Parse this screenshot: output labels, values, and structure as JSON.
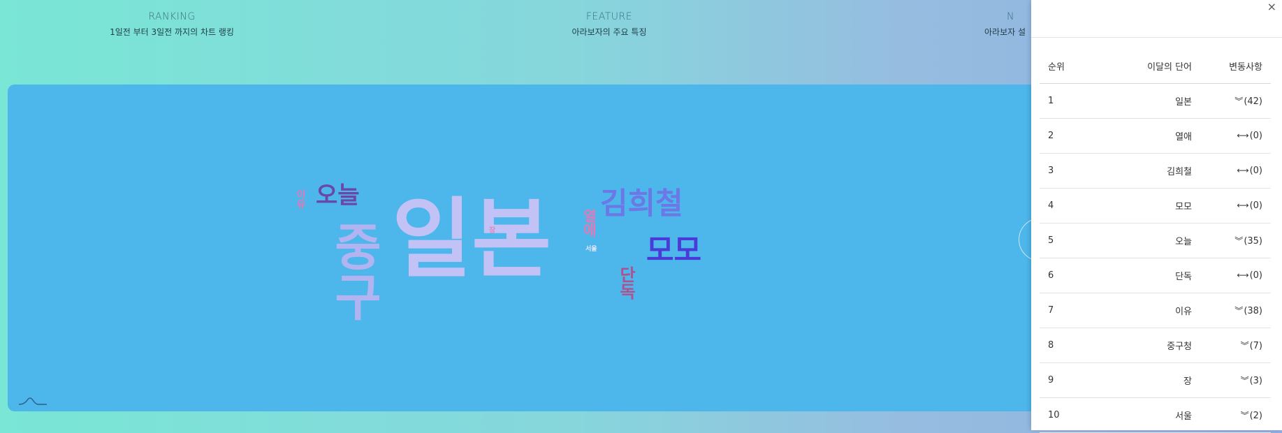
{
  "nav": [
    {
      "title": "RANKING",
      "subtitle": "1일전 부터 3일전 까지의 차트 랭킹"
    },
    {
      "title": "FEATURE",
      "subtitle": "아라보자의 주요 특징"
    },
    {
      "title": "N",
      "subtitle": "아라보자 설"
    }
  ],
  "cloud": {
    "words": [
      "일본",
      "중구",
      "김희철",
      "모모",
      "오늘",
      "열애",
      "단독",
      "이유",
      "서울",
      "장"
    ],
    "colors": {
      "panel": "#4db6ea",
      "lavender": "#c2c2f6",
      "purple": "#6a48a8",
      "indigo": "#4a3ad8",
      "violet": "#6b78e6",
      "pink": "#e07ab8",
      "magenta": "#b0508e"
    }
  },
  "drawer": {
    "close_label": "×",
    "headers": {
      "rank": "순위",
      "word": "이달의 단어",
      "change": "변동사항"
    },
    "rows": [
      {
        "rank": "1",
        "word": "일본",
        "icon": "double-chevron-down-icon",
        "glyph": "︾",
        "change": "(42)"
      },
      {
        "rank": "2",
        "word": "열애",
        "icon": "left-right-arrow-icon",
        "glyph": "⟷",
        "change": "(0)"
      },
      {
        "rank": "3",
        "word": "김희철",
        "icon": "left-right-arrow-icon",
        "glyph": "⟷",
        "change": "(0)"
      },
      {
        "rank": "4",
        "word": "모모",
        "icon": "left-right-arrow-icon",
        "glyph": "⟷",
        "change": "(0)"
      },
      {
        "rank": "5",
        "word": "오늘",
        "icon": "double-chevron-down-icon",
        "glyph": "︾",
        "change": "(35)"
      },
      {
        "rank": "6",
        "word": "단독",
        "icon": "left-right-arrow-icon",
        "glyph": "⟷",
        "change": "(0)"
      },
      {
        "rank": "7",
        "word": "이유",
        "icon": "double-chevron-down-icon",
        "glyph": "︾",
        "change": "(38)"
      },
      {
        "rank": "8",
        "word": "중구청",
        "icon": "double-chevron-down-icon",
        "glyph": "︾",
        "change": "(7)"
      },
      {
        "rank": "9",
        "word": "장",
        "icon": "double-chevron-down-icon",
        "glyph": "︾",
        "change": "(3)"
      },
      {
        "rank": "10",
        "word": "서울",
        "icon": "double-chevron-down-icon",
        "glyph": "︾",
        "change": "(2)"
      }
    ]
  }
}
